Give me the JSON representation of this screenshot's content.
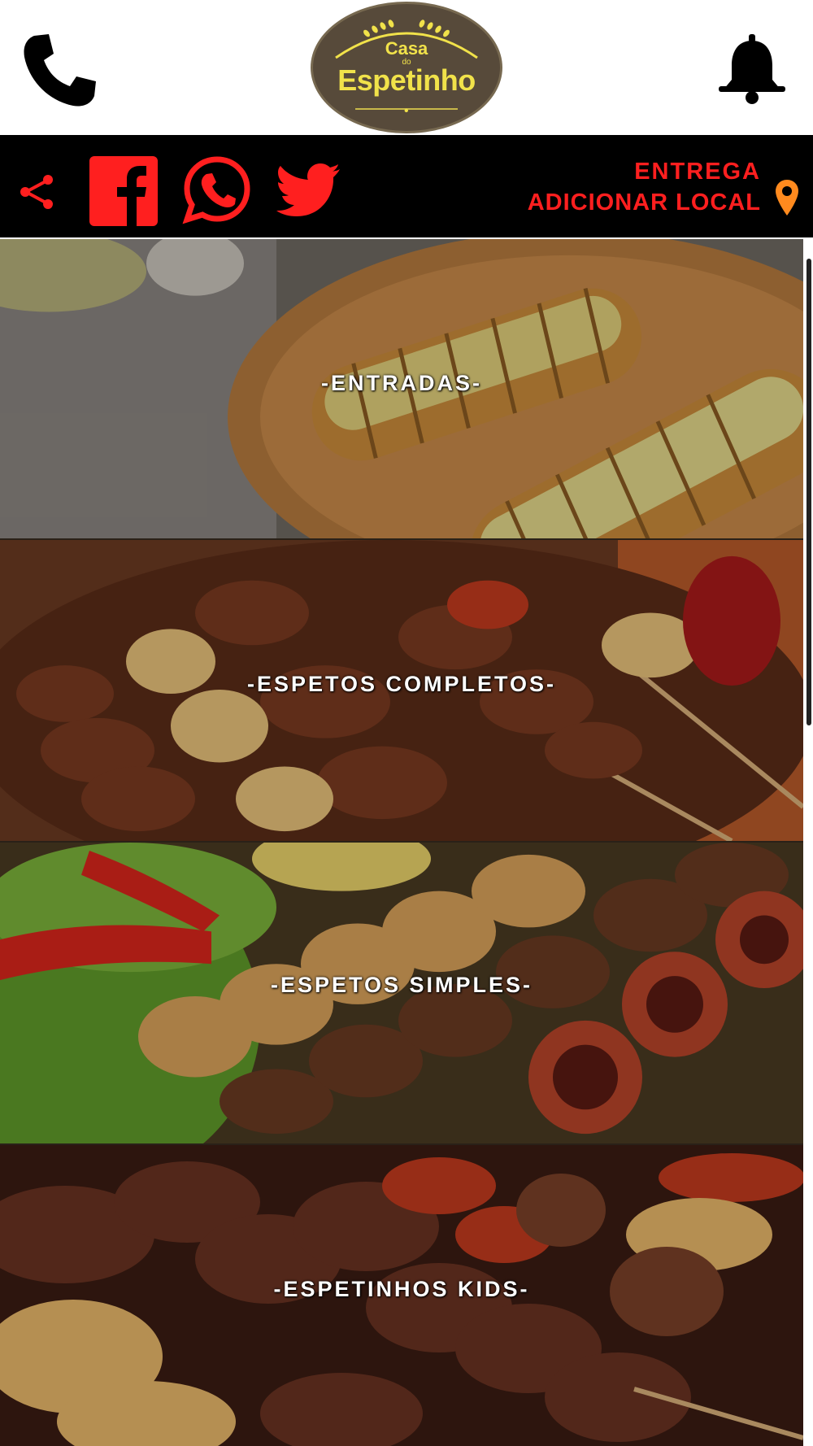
{
  "header": {
    "logo": {
      "line1": "Casa",
      "line2": "do",
      "line3": "Espetinho"
    },
    "call_icon": "phone-icon",
    "notify_icon": "bell-icon"
  },
  "social": {
    "share_icon": "share-icon",
    "facebook_icon": "facebook-icon",
    "whatsapp_icon": "whatsapp-icon",
    "twitter_icon": "twitter-icon",
    "delivery_title": "ENTREGA",
    "delivery_action": "ADICIONAR LOCAL",
    "location_icon": "map-pin-icon",
    "accent_color": "#ff1f1f",
    "pin_color": "#ff8a1e"
  },
  "categories": [
    {
      "label": "-ENTRADAS-"
    },
    {
      "label": "-ESPETOS COMPLETOS-"
    },
    {
      "label": "-ESPETOS SIMPLES-"
    },
    {
      "label": "-ESPETINHOS KIDS-"
    }
  ]
}
